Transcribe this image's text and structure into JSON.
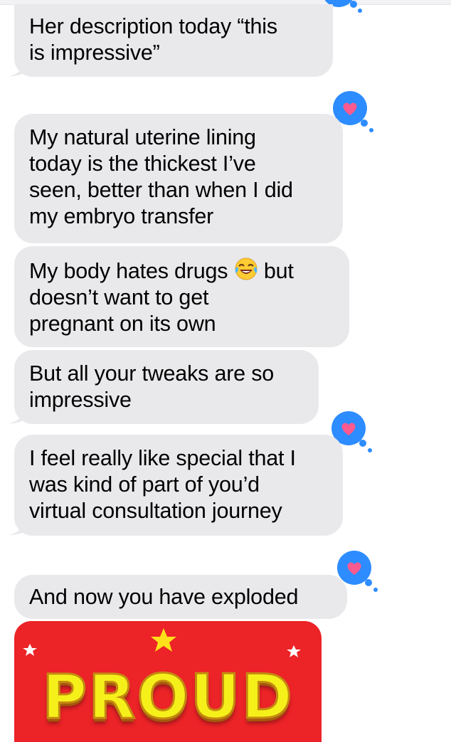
{
  "messages": [
    {
      "text": "Her description today “this\nis impressive”"
    },
    {
      "text": "My natural uterine lining\ntoday is the thickest I’ve\nseen, better than when I did\nmy embryo transfer"
    },
    {
      "text_before": "My body hates drugs ",
      "emoji": "face-with-tears-of-joy",
      "text_after": " but\ndoesn’t want to get\npregnant on its own"
    },
    {
      "text": "But all your tweaks are so\nimpressive"
    },
    {
      "text": "I feel really like special that I\nwas kind of part of you’d\nvirtual consultation journey"
    },
    {
      "text": "And now you have exploded"
    }
  ],
  "tapback": {
    "icon": "heart-icon",
    "bubble_color": "#2d8cff",
    "heart_color": "#ff5a8f"
  },
  "sticker": {
    "word": "PROUD",
    "background": "#ec2327",
    "text_color": "#f6f01a"
  },
  "colors": {
    "received_bubble": "#e9e9eb",
    "text": "#000000"
  }
}
